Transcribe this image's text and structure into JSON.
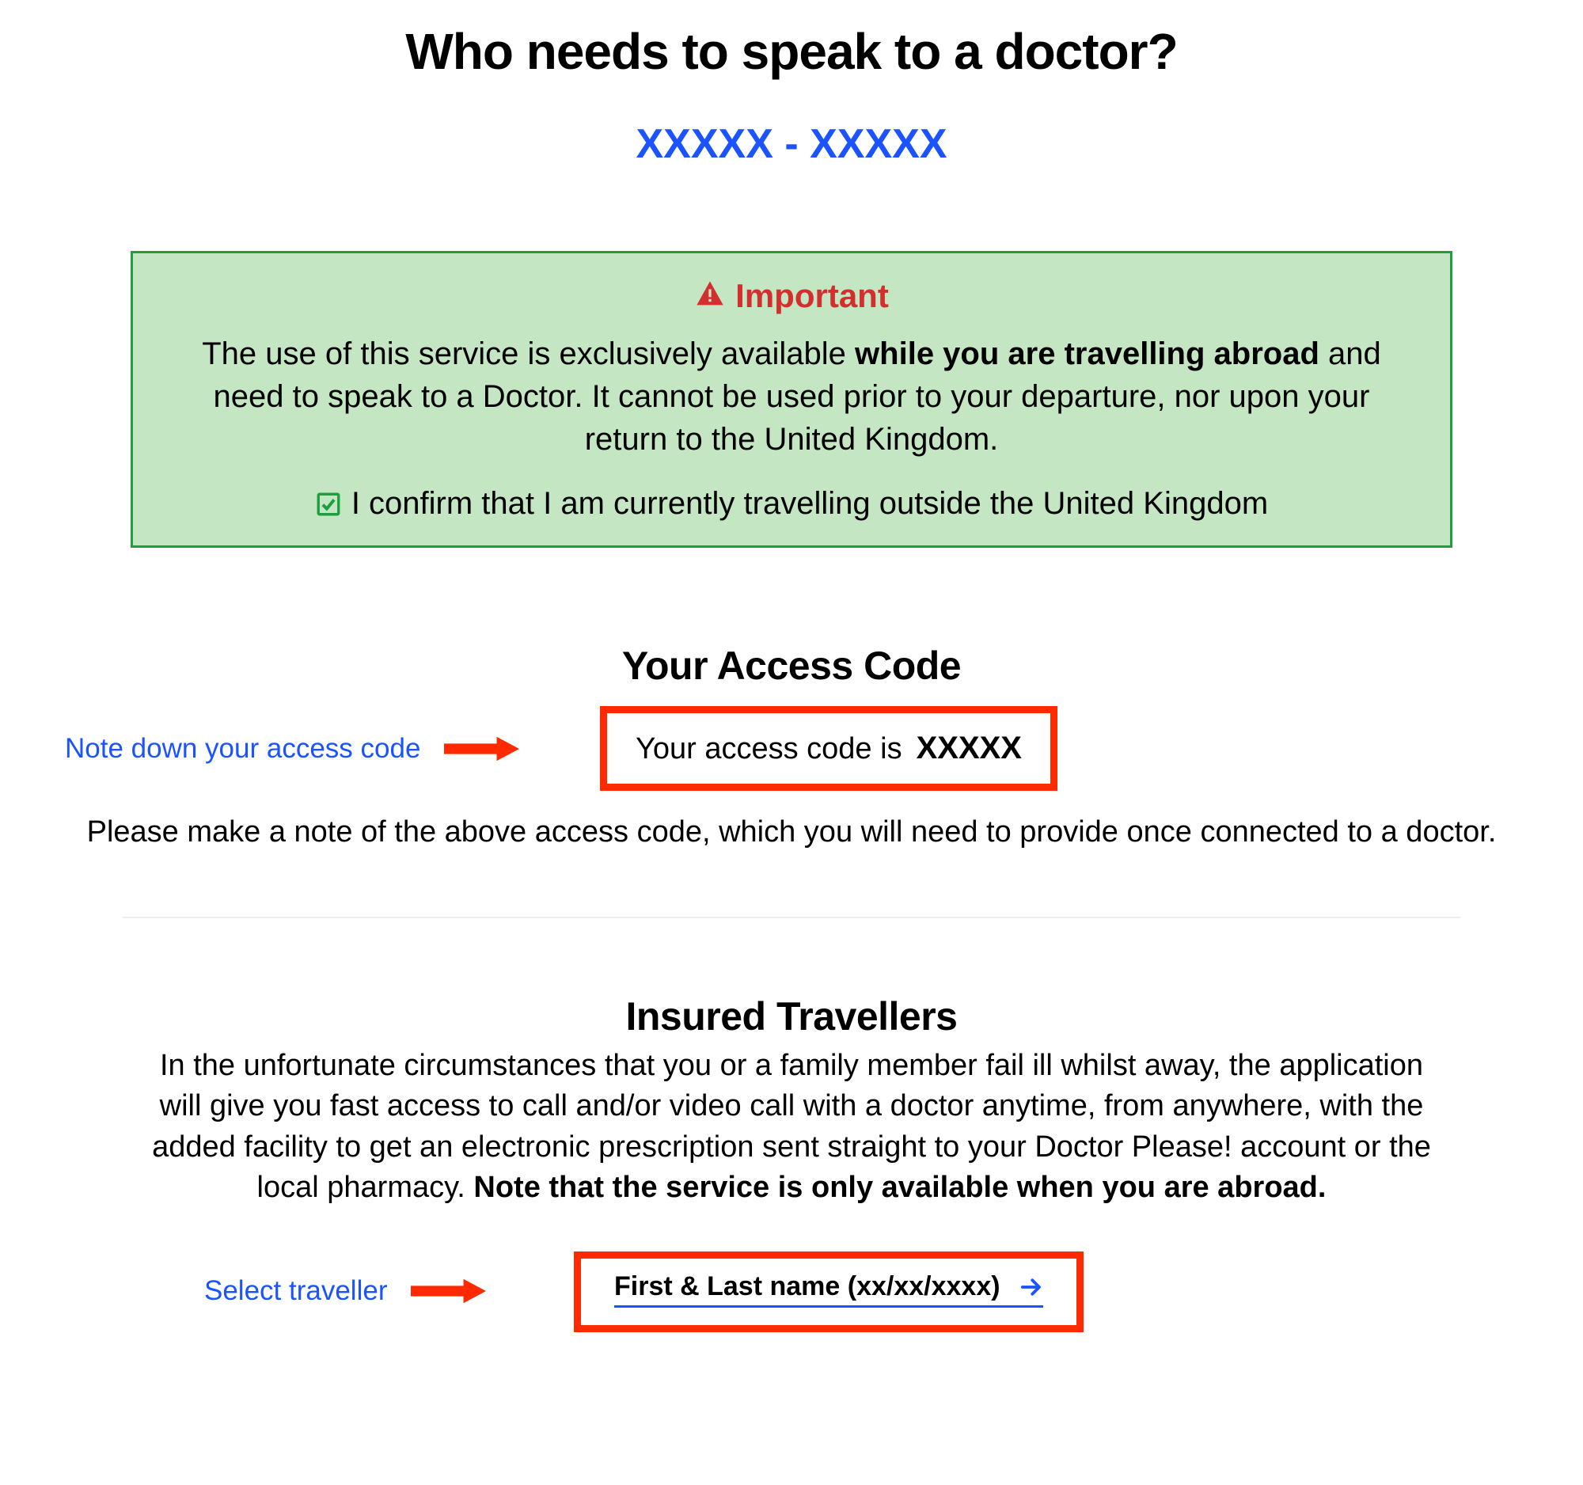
{
  "header": {
    "title": "Who needs to speak to a doctor?",
    "subtitle_code": "XXXXX - XXXXX"
  },
  "important_box": {
    "header_label": "Important",
    "body_prefix": "The use of this service is exclusively available ",
    "body_bold": "while you are travelling abroad",
    "body_suffix": " and need to speak to a Doctor. It cannot be used prior to your departure, nor upon your return to the United Kingdom.",
    "confirm_text": "I confirm that I am currently travelling outside the United Kingdom"
  },
  "access_code": {
    "section_title": "Your Access Code",
    "annotation": "Note down your access code",
    "label": "Your access code is",
    "value": "XXXXX",
    "note": "Please make a note of the above access code, which you will need to provide once connected to a doctor."
  },
  "insured": {
    "section_title": "Insured Travellers",
    "body_prefix": "In the unfortunate circumstances that you or a family member fail ill whilst away, the application will give you fast access to call and/or video call with a doctor anytime, from anywhere, with the added facility to get an electronic prescription sent straight to your Doctor Please! account or the local pharmacy. ",
    "body_bold": "Note that the service is only available when you are abroad.",
    "annotation": "Select traveller",
    "link_text": "First & Last name (xx/xx/xxxx)"
  },
  "colors": {
    "accent_blue": "#1a53ff",
    "alert_red": "#d32f2f",
    "highlight_red": "#ff2a00",
    "box_green_border": "#1f9e3f",
    "box_green_bg": "#c4e6c3"
  }
}
